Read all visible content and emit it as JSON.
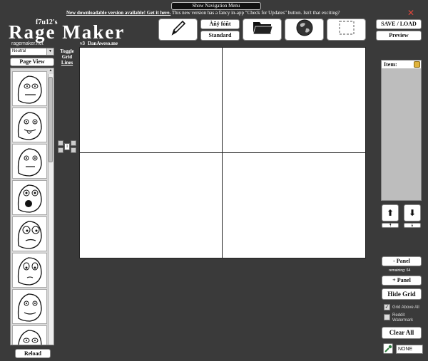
{
  "header": {
    "nav_menu_label": "Show Navigation Menu",
    "notice_link": "New downloadable version available! Get it here.",
    "notice_text": " This new version has a fancy in-app \"Check for Updates\" button. Isn't that exciting?",
    "close_glyph": "✕"
  },
  "brand": {
    "subtitle": "f7u12's",
    "title": "Rage Maker",
    "site": "ragemaker.net",
    "version": "v3",
    "author": "DanAweso.me"
  },
  "toolbar": {
    "any_font_label": "Àñÿ fóñt",
    "standard_label": "Standard",
    "save_load_label": "SAVE / LOAD",
    "preview_label": "Preview"
  },
  "left": {
    "category_value": "Neutral",
    "page_view_label": "Page View",
    "reload_label": "Reload",
    "toggle_grid_lines": [
      "Toggle",
      "Grid",
      "Lines"
    ]
  },
  "zoom": {
    "value": "1"
  },
  "right": {
    "item_label": "Item:",
    "minus_panel_label": "- Panel",
    "remaining_text": "remaining: 64",
    "plus_panel_label": "+ Panel",
    "hide_grid_label": "Hide Grid",
    "grid_above_all_label": "Grid Above All",
    "grid_above_all_checked": true,
    "reddit_watermark_label": "Reddit Watermark",
    "reddit_watermark_checked": false,
    "clear_all_label": "Clear All",
    "color_value": "NONE"
  },
  "colors": {
    "background": "#3a3a3a",
    "close_red": "#e3463b"
  }
}
